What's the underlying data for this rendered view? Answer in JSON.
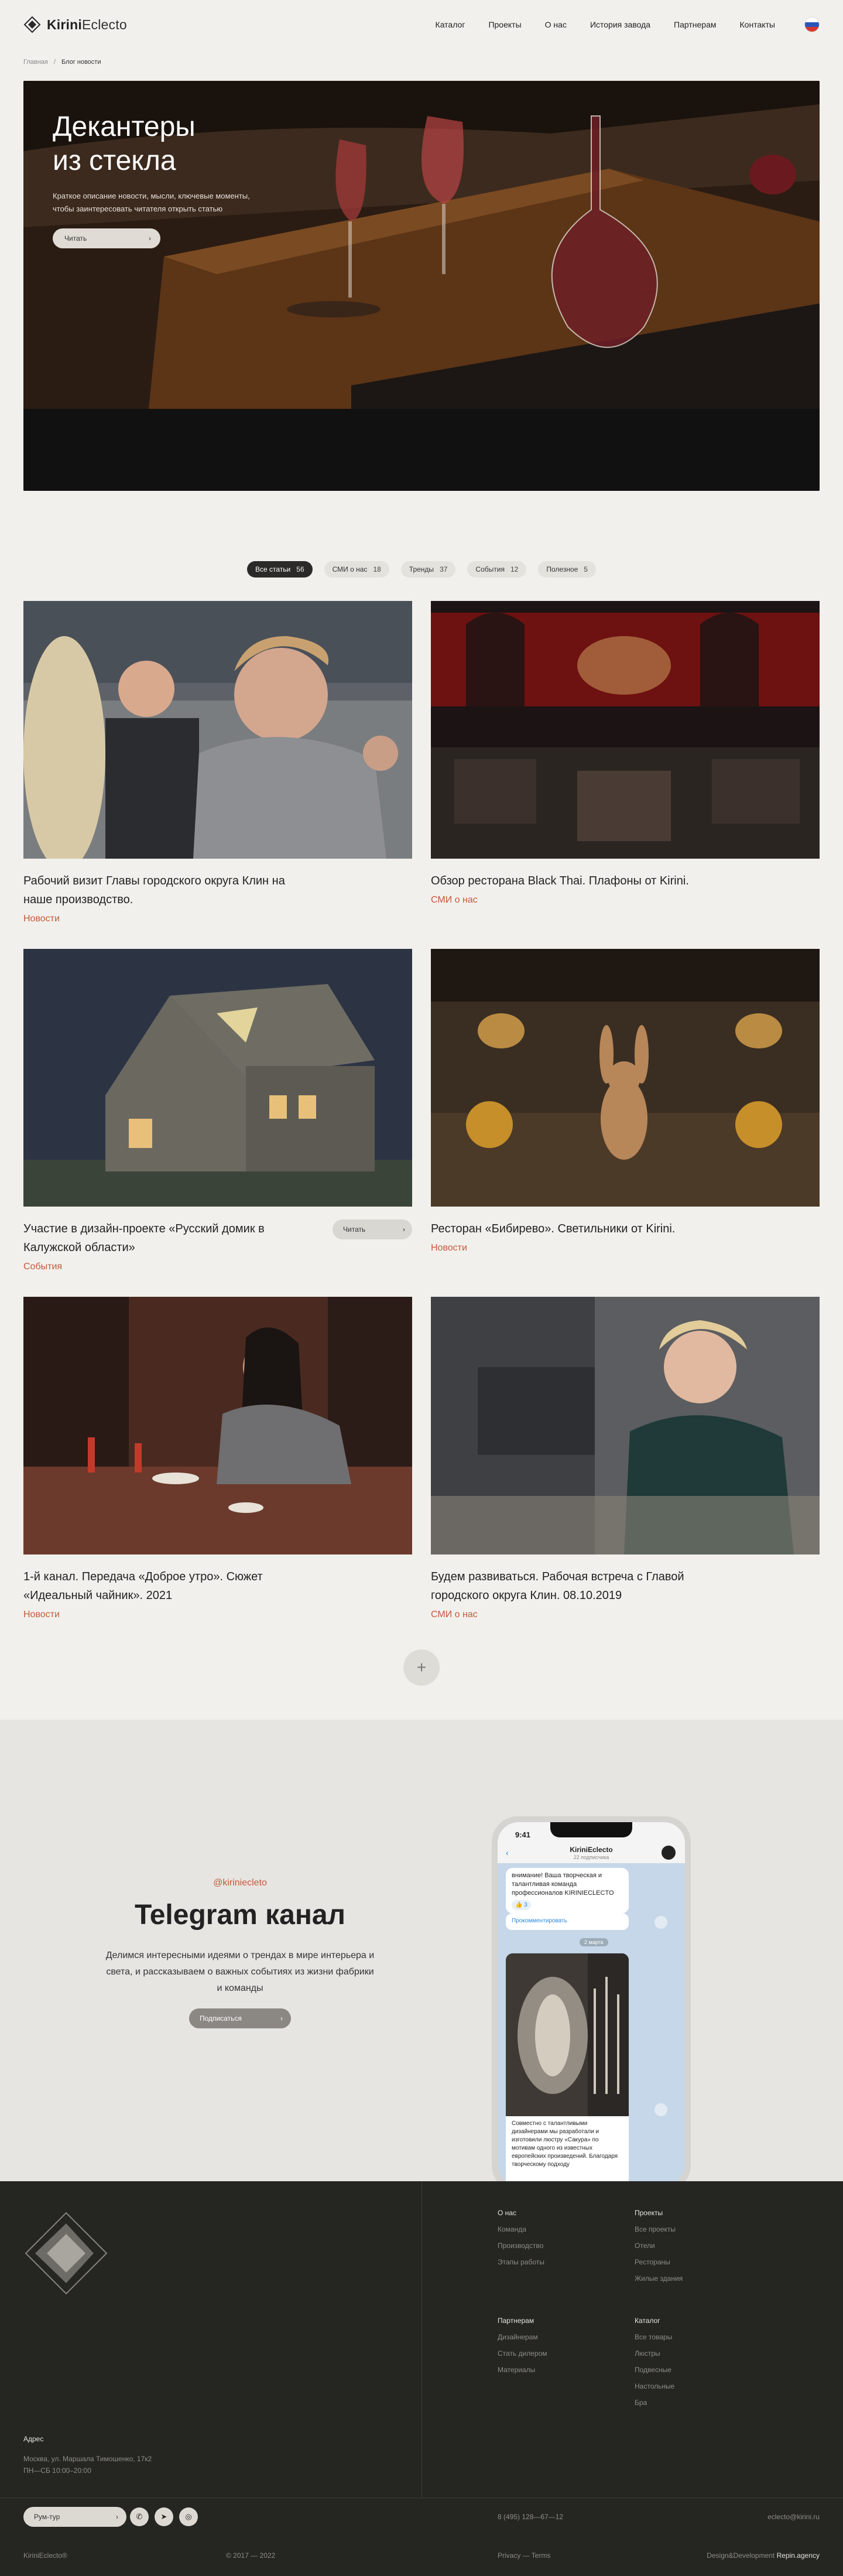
{
  "header": {
    "brand_bold": "Kirini",
    "brand_rest": "Eclecto",
    "nav": [
      "Каталог",
      "Проекты",
      "О нас",
      "История завода",
      "Партнерам",
      "Контакты"
    ]
  },
  "breadcrumb": {
    "home": "Главная",
    "current": "Блог новости"
  },
  "hero": {
    "title": "Декантеры\nиз стекла",
    "description": "Краткое описание новости, мысли, ключевые моменты, чтобы заинтересовать читателя открыть статью",
    "button": "Читать"
  },
  "filters": [
    {
      "label": "Все статьи",
      "count": "56",
      "active": true
    },
    {
      "label": "СМИ о нас",
      "count": "18",
      "active": false
    },
    {
      "label": "Тренды",
      "count": "37",
      "active": false
    },
    {
      "label": "События",
      "count": "12",
      "active": false
    },
    {
      "label": "Полезное",
      "count": "5",
      "active": false
    }
  ],
  "articles": [
    {
      "title": "Рабочий визит Главы городского округа Клин на наше производство.",
      "tag": "Новости"
    },
    {
      "title": "Обзор ресторана Black Thai. Плафоны от Kirini.",
      "tag": "СМИ о нас"
    },
    {
      "title": "Участие в дизайн-проекте «Русский домик в Калужской области»",
      "tag": "События",
      "button": "Читать"
    },
    {
      "title": "Ресторан «Бибирево». Светильники от Kirini.",
      "tag": "Новости"
    },
    {
      "title": "1-й канал. Передача «Доброе утро». Сюжет «Идеальный чайник». 2021",
      "tag": "Новости"
    },
    {
      "title": "Будем развиваться. Рабочая встреча с Главой городского округа Клин. 08.10.2019",
      "tag": "СМИ о нас"
    }
  ],
  "more_button": "+",
  "telegram": {
    "handle": "@kiriniecleto",
    "title": "Telegram канал",
    "description": "Делимся интересными идеями о трендах в мире интерьера и света, и рассказываем о важных событиях из жизни фабрики и команды",
    "button": "Подписаться",
    "phone": {
      "time": "9:41",
      "channel": "KiriniEclecto",
      "subscribers": "22 подписчика",
      "message1": "внимание! Ваша творческая и талантливая команда профессионалов KIRINIECLECTO",
      "reaction": "👍 3",
      "link": "Прокомментировать",
      "date": "2 марта",
      "caption": "Совместно с талантливыми дизайнерами мы разработали и изготовили люстру «Сакура» по мотивам одного из известных европейских произведений. Благодаря творческому подходу"
    }
  },
  "footer": {
    "col_about": {
      "title": "О нас",
      "links": [
        "Команда",
        "Производство",
        "Этапы работы"
      ]
    },
    "col_projects": {
      "title": "Проекты",
      "links": [
        "Все проекты",
        "Отели",
        "Рестораны",
        "Жилые здания"
      ]
    },
    "col_partners": {
      "title": "Партнерам",
      "links": [
        "Дизайнерам",
        "Стать дилером",
        "Материалы"
      ]
    },
    "col_catalog": {
      "title": "Каталог",
      "links": [
        "Все товары",
        "Люстры",
        "Подвесные",
        "Настольные",
        "Бра"
      ]
    },
    "address_title": "Адрес",
    "address": "Москва, ул. Маршала Тимошенко, 17к2",
    "hours": "ПН—СБ 10:00–20:00",
    "lang": "Рум-тур",
    "phone": "8 (495) 128—67—12",
    "email": "eclecto@kirini.ru",
    "brand": "KiriniEclecto®",
    "years": "© 2017 — 2022",
    "privacy": "Privacy — Terms",
    "dev_prefix": "Design&Development",
    "dev_name": "Repin.agency"
  }
}
